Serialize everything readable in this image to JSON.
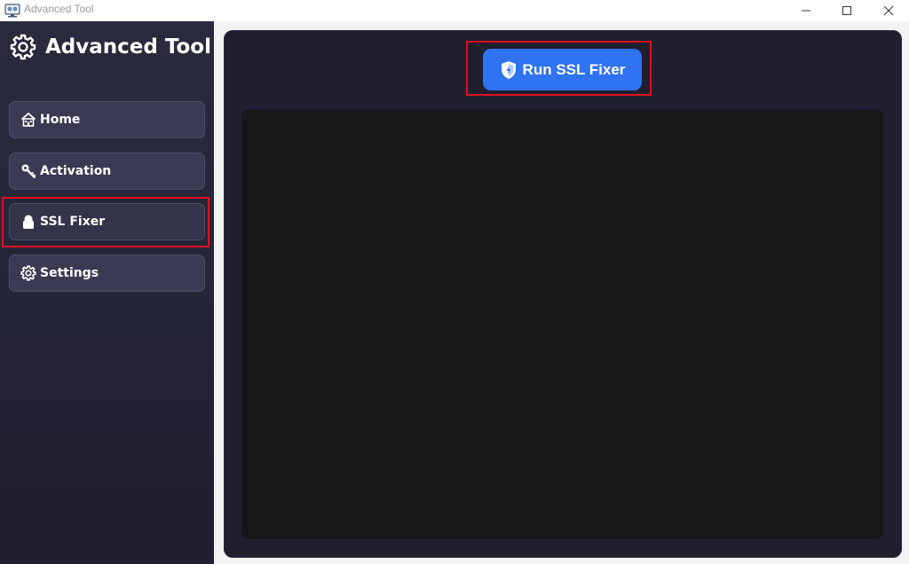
{
  "window": {
    "title": "Advanced Tool",
    "controls": [
      "minimize",
      "maximize",
      "close"
    ]
  },
  "sidebar": {
    "brand_title": "Advanced Tool",
    "brand_icon": "gear-icon",
    "items": [
      {
        "label": "Home",
        "icon": "home-icon",
        "active": false
      },
      {
        "label": "Activation",
        "icon": "key-icon",
        "active": false
      },
      {
        "label": "SSL Fixer",
        "icon": "lock-icon",
        "active": true
      },
      {
        "label": "Settings",
        "icon": "gear-icon",
        "active": false
      }
    ]
  },
  "main": {
    "run_button_label": "Run SSL Fixer",
    "run_button_icon": "shield-icon",
    "output_text": ""
  },
  "colors": {
    "sidebar_bg": "#2a2a3e",
    "panel_bg": "#1f1f30",
    "output_bg": "#171717",
    "accent": "#2f72f2",
    "highlight": "#e0101f"
  }
}
